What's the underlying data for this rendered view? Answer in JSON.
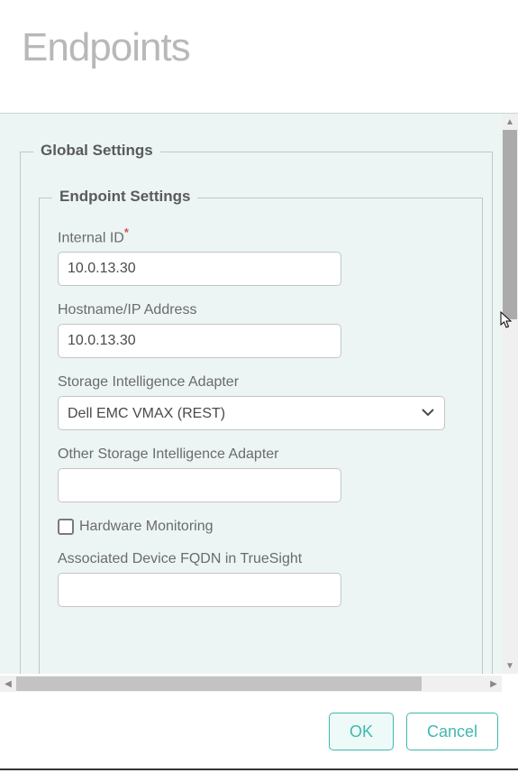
{
  "page": {
    "title": "Endpoints"
  },
  "globalSettings": {
    "legend": "Global Settings"
  },
  "endpointSettings": {
    "legend": "Endpoint Settings",
    "internalId": {
      "label": "Internal ID",
      "required": true,
      "value": "10.0.13.30"
    },
    "hostname": {
      "label": "Hostname/IP Address",
      "value": "10.0.13.30"
    },
    "storageAdapter": {
      "label": "Storage Intelligence Adapter",
      "value": "Dell EMC VMAX (REST)"
    },
    "otherAdapter": {
      "label": "Other Storage Intelligence Adapter",
      "value": ""
    },
    "hardwareMonitoring": {
      "label": "Hardware Monitoring",
      "checked": false
    },
    "associatedFqdn": {
      "label": "Associated Device FQDN in TrueSight",
      "value": ""
    }
  },
  "footer": {
    "ok": "OK",
    "cancel": "Cancel"
  }
}
